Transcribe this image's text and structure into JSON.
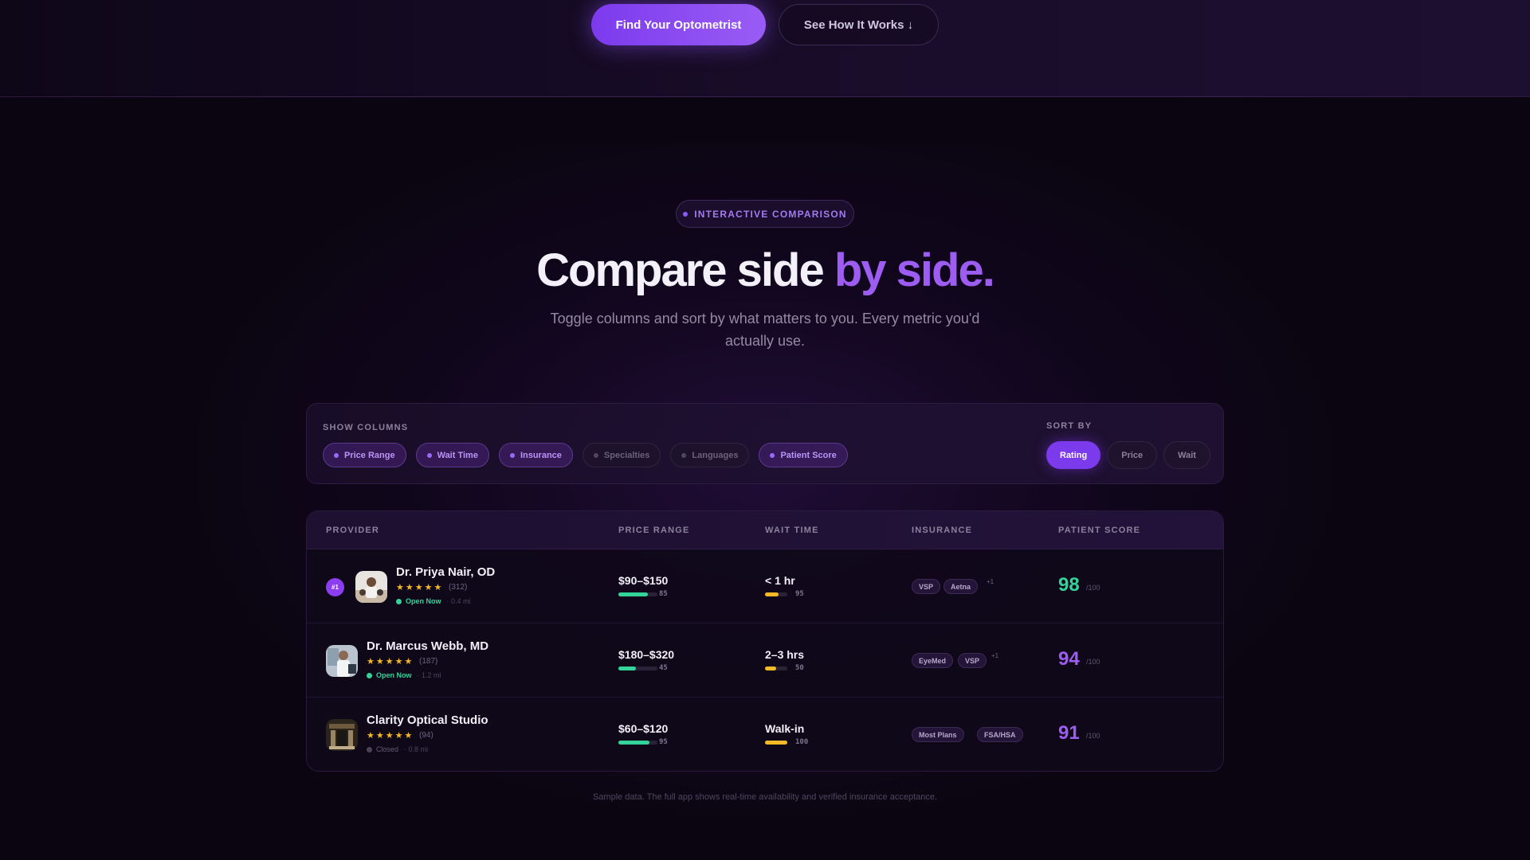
{
  "hero": {
    "primary_cta": "Find Your Optometrist",
    "secondary_cta": "See How It Works ↓"
  },
  "section": {
    "tag": "INTERACTIVE COMPARISON",
    "headline_main": "Compare side ",
    "headline_accent": "by side.",
    "subhead": "Toggle columns and sort by what matters to you. Every metric you'd actually use."
  },
  "controls": {
    "show_columns_label": "SHOW COLUMNS",
    "columns": [
      {
        "label": "Price Range",
        "active": true
      },
      {
        "label": "Wait Time",
        "active": true
      },
      {
        "label": "Insurance",
        "active": true
      },
      {
        "label": "Specialties",
        "active": false
      },
      {
        "label": "Languages",
        "active": false
      },
      {
        "label": "Patient Score",
        "active": true
      }
    ],
    "sort_by_label": "SORT BY",
    "sort_options": [
      {
        "label": "Rating",
        "active": true
      },
      {
        "label": "Price",
        "active": false
      },
      {
        "label": "Wait",
        "active": false
      }
    ]
  },
  "table": {
    "headers": {
      "provider": "PROVIDER",
      "price": "PRICE RANGE",
      "wait": "WAIT TIME",
      "insurance": "INSURANCE",
      "score": "PATIENT SCORE"
    },
    "rows": [
      {
        "rank": "#1",
        "name": "Dr. Priya Nair, OD",
        "stars": "★★★★★",
        "reviews": "(312)",
        "status": "Open Now",
        "distance": "· 0.4 mi",
        "price": "$90–$150",
        "price_score": "85",
        "price_fill": 0.75,
        "wait": "< 1 hr",
        "wait_score": "95",
        "wait_fill": 0.6,
        "insurance": [
          "VSP",
          "Aetna"
        ],
        "insurance_more": "+1",
        "score": "98",
        "score_max": "/100",
        "score_color": "#34d399"
      },
      {
        "rank": "",
        "name": "Dr. Marcus Webb, MD",
        "stars": "★★★★★",
        "reviews": "(187)",
        "status": "Open Now",
        "distance": "· 1.2 mi",
        "price": "$180–$320",
        "price_score": "45",
        "price_fill": 0.45,
        "wait": "2–3 hrs",
        "wait_score": "50",
        "wait_fill": 0.5,
        "insurance": [
          "EyeMed",
          "VSP"
        ],
        "insurance_more": "+1",
        "score": "94",
        "score_max": "/100",
        "score_color": "#9d5cf2"
      },
      {
        "rank": "",
        "name": "Clarity Optical Studio",
        "stars": "★★★★★",
        "reviews": "(94)",
        "status": "Closed",
        "distance": "· 0.8 mi",
        "price": "$60–$120",
        "price_score": "95",
        "price_fill": 0.8,
        "wait": "Walk-in",
        "wait_score": "100",
        "wait_fill": 1.0,
        "insurance": [
          "Most Plans",
          "FSA/HSA"
        ],
        "insurance_more": "",
        "score": "91",
        "score_max": "/100",
        "score_color": "#9d5cf2"
      }
    ]
  },
  "footnote": "Sample data. The full app shows real-time availability and verified insurance acceptance.",
  "colors": {
    "accent": "#7c3aed",
    "accent_light": "#9d5cf2",
    "green": "#34d399",
    "amber": "#f5b827"
  }
}
